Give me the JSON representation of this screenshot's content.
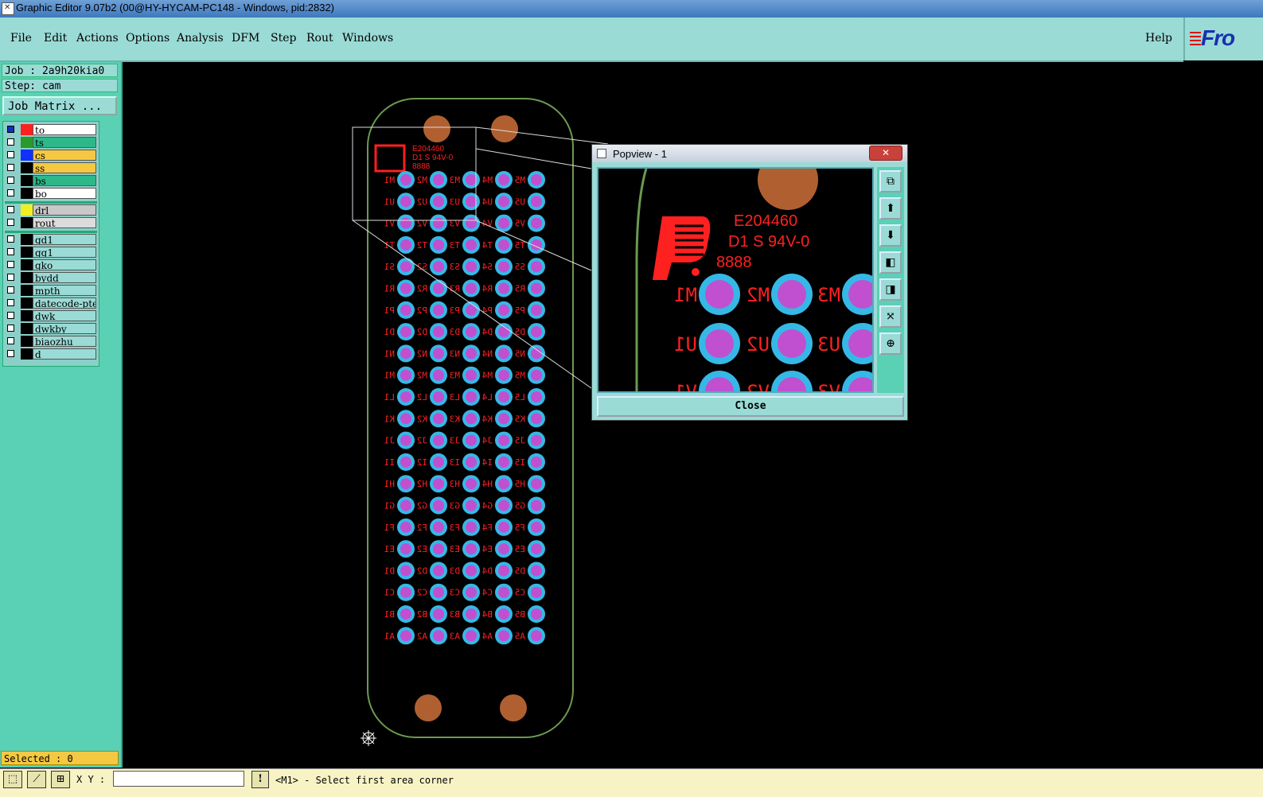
{
  "window": {
    "title": "Graphic Editor 9.07b2 (00@HY-HYCAM-PC148 - Windows, pid:2832)"
  },
  "menu": {
    "items": [
      "File",
      "Edit",
      "Actions",
      "Options",
      "Analysis",
      "DFM",
      "Step",
      "Rout",
      "Windows"
    ],
    "help": "Help"
  },
  "logo": {
    "text_main": "Fro",
    "icon": "frontline-logo-icon"
  },
  "job": {
    "job_label": "Job : 2a9h20kia0",
    "step_label": "Step: cam",
    "matrix_button": "Job Matrix ..."
  },
  "layers": [
    {
      "name": "to",
      "color": "#ff2020",
      "bg": "#ffffff",
      "marked": true
    },
    {
      "name": "ts",
      "color": "#2a9a2a",
      "bg": "#2eb88a",
      "marked": false
    },
    {
      "name": "cs",
      "color": "#1030ff",
      "bg": "#f5c842",
      "marked": false
    },
    {
      "name": "ss",
      "color": "#000000",
      "bg": "#f5c842",
      "marked": false
    },
    {
      "name": "bs",
      "color": "#000000",
      "bg": "#2eb88a",
      "marked": false
    },
    {
      "name": "bo",
      "color": "#000000",
      "bg": "#ffffff",
      "marked": false
    },
    {
      "name": "drl",
      "color": "#f0f020",
      "bg": "#c8c8c8",
      "marked": false
    },
    {
      "name": "rout",
      "color": "#000000",
      "bg": "#dcdcdc",
      "marked": false
    },
    {
      "name": "gd1",
      "color": "#000000",
      "bg": "#9adbd6",
      "marked": false
    },
    {
      "name": "gg1",
      "color": "#000000",
      "bg": "#9adbd6",
      "marked": false
    },
    {
      "name": "gko",
      "color": "#000000",
      "bg": "#9adbd6",
      "marked": false
    },
    {
      "name": "bydd",
      "color": "#000000",
      "bg": "#9adbd6",
      "marked": false
    },
    {
      "name": "mpth",
      "color": "#000000",
      "bg": "#9adbd6",
      "marked": false
    },
    {
      "name": "datecode-pte",
      "color": "#000000",
      "bg": "#9adbd6",
      "marked": false
    },
    {
      "name": "dwk",
      "color": "#000000",
      "bg": "#9adbd6",
      "marked": false
    },
    {
      "name": "dwkby",
      "color": "#000000",
      "bg": "#9adbd6",
      "marked": false
    },
    {
      "name": "biaozhu",
      "color": "#000000",
      "bg": "#9adbd6",
      "marked": false
    },
    {
      "name": "d",
      "color": "#000000",
      "bg": "#9adbd6",
      "marked": false
    }
  ],
  "selected": "Selected : 0",
  "status": {
    "xy_label": "X Y :",
    "xy_value": "",
    "message": "<M1> - Select first area corner"
  },
  "popview": {
    "title": "Popview - 1",
    "close_label": "Close"
  },
  "pcb": {
    "marking_lines": [
      "E204460",
      "D1 S 94V-0",
      "8888"
    ],
    "row_labels": [
      "M",
      "U",
      "V",
      "T",
      "S",
      "R",
      "P",
      "D",
      "N",
      "M",
      "L",
      "K",
      "J",
      "I",
      "H",
      "G",
      "F",
      "E",
      "D",
      "C",
      "B",
      "A"
    ],
    "columns": 5,
    "colors": {
      "outline": "#6a9a50",
      "pad_outer": "#36b8e6",
      "pad_inner": "#c050d0",
      "text": "#ff2020",
      "mount_hole": "#b06030"
    }
  },
  "icons": {
    "toolbar": [
      "select-icon",
      "measure-icon",
      "grid-icon"
    ],
    "popview_tools": [
      "zoom-home-icon",
      "pan-up-icon",
      "pan-down-icon",
      "pan-left-icon",
      "pan-right-icon",
      "zoom-fit-icon",
      "zoom-center-icon"
    ],
    "canvas": "crosshair-icon"
  }
}
